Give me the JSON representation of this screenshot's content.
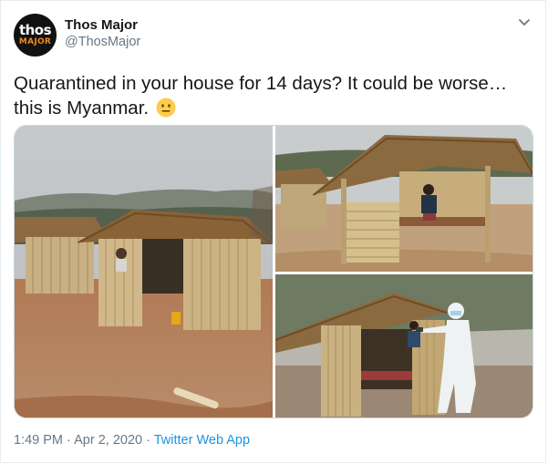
{
  "tweet": {
    "author": {
      "name": "Thos Major",
      "handle": "@ThosMajor",
      "avatar_line1": "thos",
      "avatar_line2": "MAJOR"
    },
    "text_line1": "Quarantined in your house for 14 days? It could be worse…",
    "text_line2": "this is Myanmar.",
    "emoji": "neutral-face-icon",
    "media": [
      {
        "id": "photo-1",
        "description": "bamboo huts with thatched roofs on dirt ground"
      },
      {
        "id": "photo-2",
        "description": "man sitting in an open bamboo hut"
      },
      {
        "id": "photo-3",
        "description": "health worker in protective suit taking temperature"
      }
    ],
    "time": "1:49 PM",
    "separator": "·",
    "date": "Apr 2, 2020",
    "source": "Twitter Web App"
  },
  "colors": {
    "text": "#14171a",
    "secondary": "#657786",
    "link": "#1b95e0",
    "border": "#e6ecf0"
  }
}
